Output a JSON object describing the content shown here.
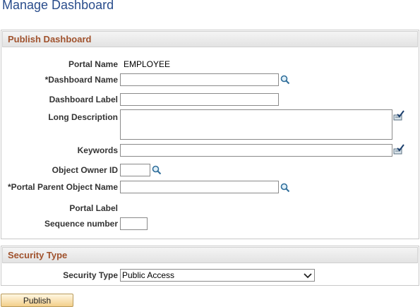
{
  "page": {
    "title": "Manage Dashboard"
  },
  "publish": {
    "header": "Publish Dashboard",
    "portal_name_label": "Portal Name",
    "portal_name_value": "EMPLOYEE",
    "dashboard_name_label": "*Dashboard Name",
    "dashboard_name_value": "",
    "dashboard_label_label": "Dashboard Label",
    "dashboard_label_value": "",
    "long_description_label": "Long Description",
    "long_description_value": "",
    "keywords_label": "Keywords",
    "keywords_value": "",
    "object_owner_label": "Object Owner ID",
    "object_owner_value": "",
    "portal_parent_label": "*Portal Parent Object Name",
    "portal_parent_value": "",
    "portal_label_label": "Portal Label",
    "sequence_label": "Sequence number",
    "sequence_value": ""
  },
  "security": {
    "header": "Security Type",
    "type_label": "Security Type",
    "type_value": "Public Access",
    "options": [
      "Public Access"
    ]
  },
  "actions": {
    "publish_label": "Publish"
  },
  "colors": {
    "title": "#2a4d8c",
    "section_header": "#a0522d"
  }
}
